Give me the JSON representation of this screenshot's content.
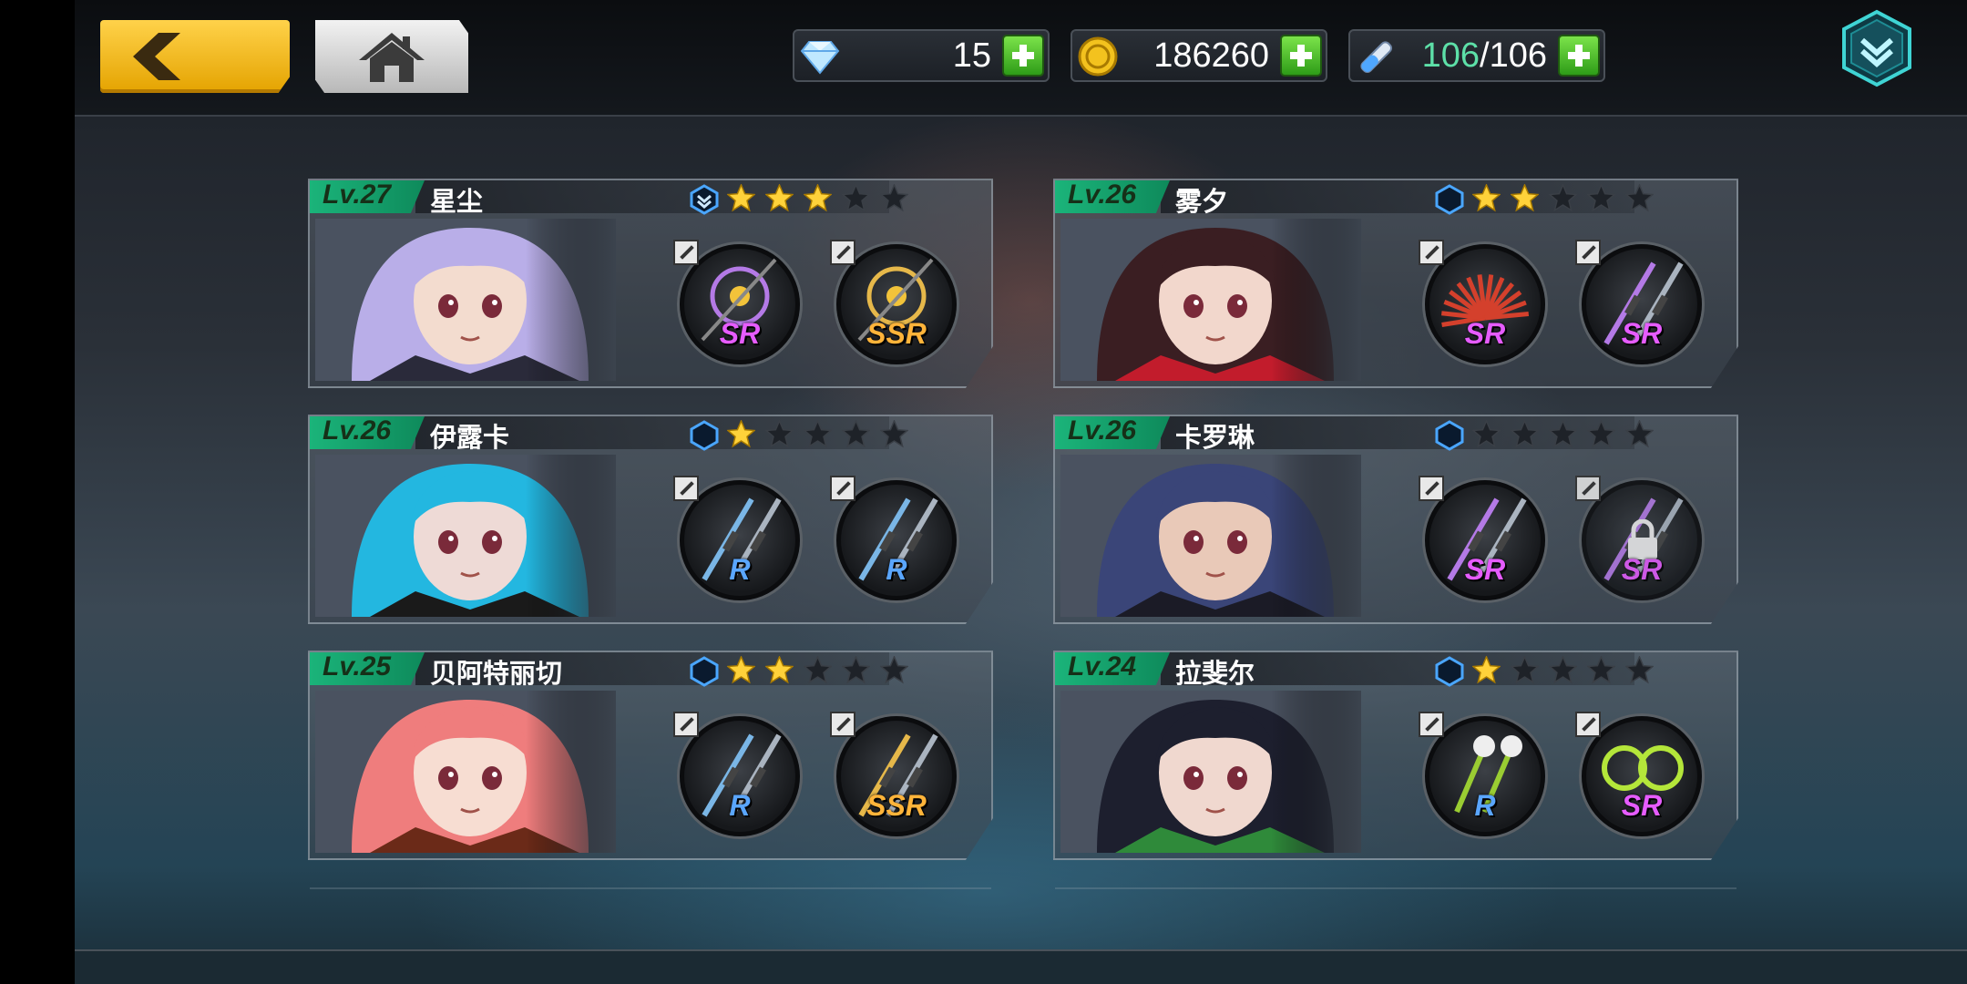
{
  "header": {
    "resources": [
      {
        "icon": "diamond-icon",
        "value": "15"
      },
      {
        "icon": "gold-coin-icon",
        "value": "186260"
      },
      {
        "icon": "stamina-vial-icon",
        "current": "106",
        "separator": "/",
        "max": "106"
      }
    ]
  },
  "characters": [
    {
      "level": "Lv.27",
      "name": "星尘",
      "stars": 3,
      "max_stars": 5,
      "emblem": "chevron-hex",
      "hair": "#b9aee8",
      "skin": "#f3dccf",
      "accent": "#2a2a3a",
      "weapons": [
        {
          "rarity": "SR",
          "tier": "sr",
          "icon": "gear-staff-icon",
          "locked": false
        },
        {
          "rarity": "SSR",
          "tier": "ssr",
          "icon": "golden-wheel-icon",
          "locked": false
        }
      ]
    },
    {
      "level": "Lv.26",
      "name": "雾夕",
      "stars": 2,
      "max_stars": 5,
      "emblem": "hex",
      "hair": "#3a1e22",
      "skin": "#f2d7cc",
      "accent": "#c21c2c",
      "weapons": [
        {
          "rarity": "SR",
          "tier": "sr",
          "icon": "fan-icon",
          "locked": false
        },
        {
          "rarity": "SR",
          "tier": "sr",
          "icon": "chain-blade-icon",
          "locked": false
        }
      ]
    },
    {
      "level": "Lv.26",
      "name": "伊露卡",
      "stars": 1,
      "max_stars": 5,
      "emblem": "hex",
      "hair": "#23b7e0",
      "skin": "#eedad6",
      "accent": "#1a1a1a",
      "weapons": [
        {
          "rarity": "R",
          "tier": "r",
          "icon": "twin-daggers-icon",
          "locked": false
        },
        {
          "rarity": "R",
          "tier": "r",
          "icon": "twin-blades-icon",
          "locked": false
        }
      ]
    },
    {
      "level": "Lv.26",
      "name": "卡罗琳",
      "stars": 0,
      "max_stars": 5,
      "emblem": "hex",
      "hair": "#3a4578",
      "skin": "#e9c9b8",
      "accent": "#1b1b26",
      "weapons": [
        {
          "rarity": "SR",
          "tier": "sr",
          "icon": "twin-daggers-icon",
          "locked": false
        },
        {
          "rarity": "SR",
          "tier": "sr",
          "icon": "dark-blades-icon",
          "locked": true
        }
      ]
    },
    {
      "level": "Lv.25",
      "name": "贝阿特丽切",
      "stars": 2,
      "max_stars": 5,
      "emblem": "hex",
      "hair": "#ef7d7d",
      "skin": "#f7ddd2",
      "accent": "#6b2a18",
      "weapons": [
        {
          "rarity": "R",
          "tier": "r",
          "icon": "rapier-icon",
          "locked": false
        },
        {
          "rarity": "SSR",
          "tier": "ssr",
          "icon": "great-sword-icon",
          "locked": false
        }
      ]
    },
    {
      "level": "Lv.24",
      "name": "拉斐尔",
      "stars": 1,
      "max_stars": 5,
      "emblem": "hex",
      "hair": "#1d1f2e",
      "skin": "#f0d8cf",
      "accent": "#2f8a3a",
      "weapons": [
        {
          "rarity": "R",
          "tier": "r",
          "icon": "flower-wands-icon",
          "locked": false
        },
        {
          "rarity": "SR",
          "tier": "sr",
          "icon": "thorn-rings-icon",
          "locked": false
        }
      ]
    }
  ]
}
